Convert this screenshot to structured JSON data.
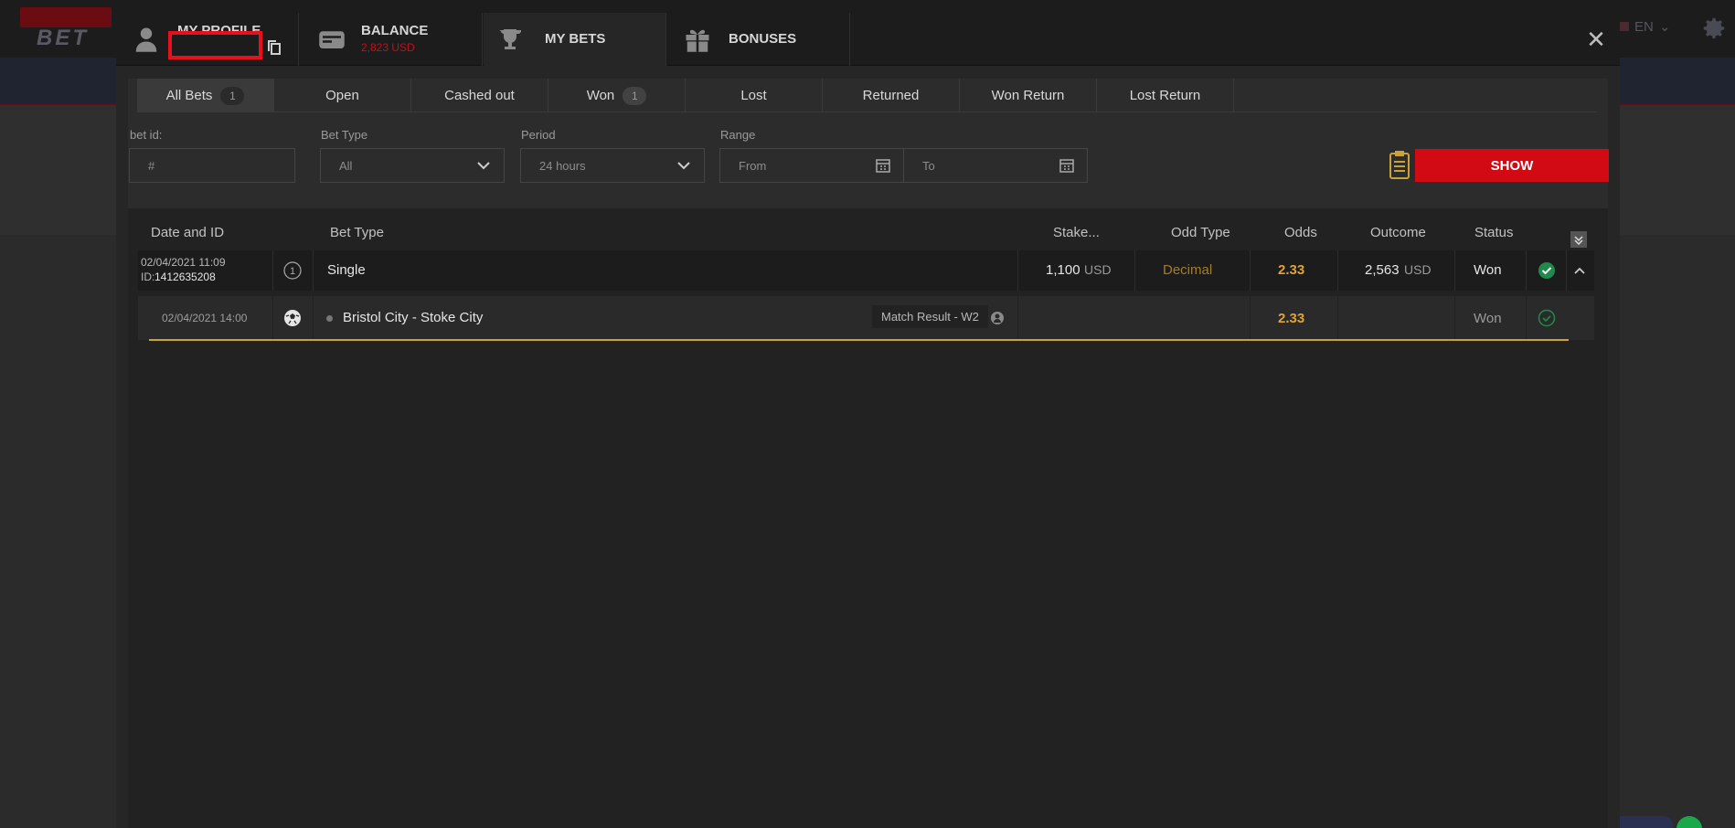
{
  "site": {
    "logo_text": "BET",
    "language": "EN"
  },
  "profile_tabs": [
    {
      "title": "MY PROFILE",
      "sub": ""
    },
    {
      "title": "BALANCE",
      "sub": "2,823 USD"
    },
    {
      "title": "MY BETS",
      "sub": ""
    },
    {
      "title": "BONUSES",
      "sub": ""
    }
  ],
  "bet_tabs": [
    {
      "label": "All Bets",
      "count": "1"
    },
    {
      "label": "Open",
      "count": ""
    },
    {
      "label": "Cashed out",
      "count": ""
    },
    {
      "label": "Won",
      "count": "1"
    },
    {
      "label": "Lost",
      "count": ""
    },
    {
      "label": "Returned",
      "count": ""
    },
    {
      "label": "Won Return",
      "count": ""
    },
    {
      "label": "Lost Return",
      "count": ""
    }
  ],
  "filters": {
    "bet_id_label": "bet id:",
    "bet_id_placeholder": "#",
    "bet_type_label": "Bet Type",
    "bet_type_value": "All",
    "period_label": "Period",
    "period_value": "24 hours",
    "range_label": "Range",
    "from_placeholder": "From",
    "to_placeholder": "To",
    "show_label": "SHOW"
  },
  "columns": {
    "date_id": "Date and ID",
    "bet_type": "Bet Type",
    "stake": "Stake...",
    "odd_type": "Odd Type",
    "odds": "Odds",
    "outcome": "Outcome",
    "status": "Status"
  },
  "bet": {
    "datetime": "02/04/2021 11:09",
    "id_label": "ID:",
    "id": "1412635208",
    "count_icon": "1",
    "type": "Single",
    "stake": "1,100",
    "stake_currency": "USD",
    "odd_type": "Decimal",
    "odds": "2.33",
    "outcome": "2,563",
    "outcome_currency": "USD",
    "status": "Won",
    "event": {
      "datetime": "02/04/2021 14:00",
      "match": "Bristol City - Stoke City",
      "market": "Match Result - W2",
      "odds": "2.33",
      "status": "Won",
      "sport_icon": "soccer-ball-icon"
    }
  },
  "colors": {
    "accent_red": "#d10a14",
    "won_green": "#1f8a4c",
    "odds_gold": "#e0a23a"
  }
}
